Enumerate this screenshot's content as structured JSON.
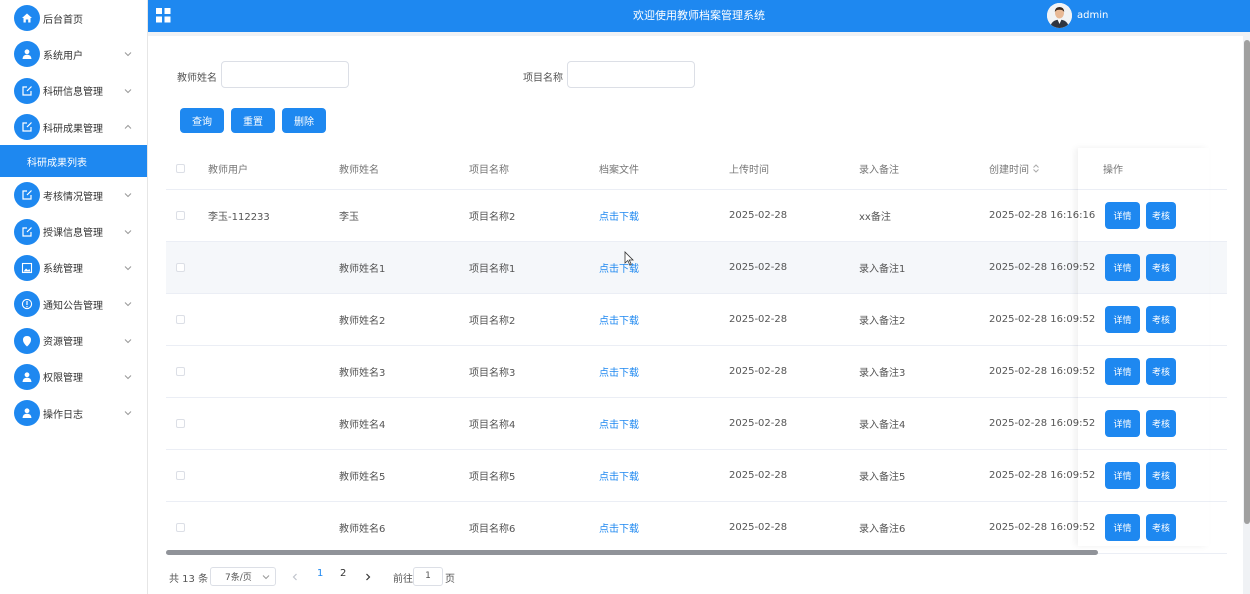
{
  "header": {
    "title": "欢迎使用教师档案管理系统",
    "username": "admin"
  },
  "sidebar": {
    "items": [
      {
        "label": "后台首页",
        "icon": "home-icon",
        "chevron": false
      },
      {
        "label": "系统用户",
        "icon": "user-icon",
        "chevron": "down"
      },
      {
        "label": "科研信息管理",
        "icon": "edit-icon",
        "chevron": "down"
      },
      {
        "label": "科研成果管理",
        "icon": "edit-icon",
        "chevron": "up"
      },
      {
        "label": "考核情况管理",
        "icon": "edit-icon",
        "chevron": "down"
      },
      {
        "label": "授课信息管理",
        "icon": "edit-icon",
        "chevron": "down"
      },
      {
        "label": "系统管理",
        "icon": "image-icon",
        "chevron": "down"
      },
      {
        "label": "通知公告管理",
        "icon": "info-icon",
        "chevron": "down"
      },
      {
        "label": "资源管理",
        "icon": "location-icon",
        "chevron": "down"
      },
      {
        "label": "权限管理",
        "icon": "user-icon",
        "chevron": "down"
      },
      {
        "label": "操作日志",
        "icon": "user-icon",
        "chevron": "down"
      }
    ],
    "active_sub": "科研成果列表"
  },
  "search": {
    "teacher_label": "教师姓名",
    "project_label": "项目名称",
    "query_btn": "查询",
    "reset_btn": "重置",
    "delete_btn": "删除"
  },
  "table": {
    "columns": [
      "教师用户",
      "教师姓名",
      "项目名称",
      "档案文件",
      "上传时间",
      "录入备注",
      "创建时间",
      "操作"
    ],
    "rows": [
      {
        "user": "李玉-112233",
        "name": "李玉",
        "project": "项目名称2",
        "file": "点击下载",
        "upload": "2025-02-28",
        "note": "xx备注",
        "created": "2025-02-28 16:16:16"
      },
      {
        "user": "",
        "name": "教师姓名1",
        "project": "项目名称1",
        "file": "点击下载",
        "upload": "2025-02-28",
        "note": "录入备注1",
        "created": "2025-02-28 16:09:52"
      },
      {
        "user": "",
        "name": "教师姓名2",
        "project": "项目名称2",
        "file": "点击下载",
        "upload": "2025-02-28",
        "note": "录入备注2",
        "created": "2025-02-28 16:09:52"
      },
      {
        "user": "",
        "name": "教师姓名3",
        "project": "项目名称3",
        "file": "点击下载",
        "upload": "2025-02-28",
        "note": "录入备注3",
        "created": "2025-02-28 16:09:52"
      },
      {
        "user": "",
        "name": "教师姓名4",
        "project": "项目名称4",
        "file": "点击下载",
        "upload": "2025-02-28",
        "note": "录入备注4",
        "created": "2025-02-28 16:09:52"
      },
      {
        "user": "",
        "name": "教师姓名5",
        "project": "项目名称5",
        "file": "点击下载",
        "upload": "2025-02-28",
        "note": "录入备注5",
        "created": "2025-02-28 16:09:52"
      },
      {
        "user": "",
        "name": "教师姓名6",
        "project": "项目名称6",
        "file": "点击下载",
        "upload": "2025-02-28",
        "note": "录入备注6",
        "created": "2025-02-28 16:09:52"
      }
    ],
    "detail_btn": "详情",
    "audit_btn": "考核"
  },
  "pagination": {
    "total": "共 13 条",
    "page_size": "7条/页",
    "pages": [
      "1",
      "2"
    ],
    "current": "1",
    "goto_label": "前往",
    "goto_value": "1",
    "page_suffix": "页"
  },
  "colors": {
    "primary": "#1e88f0"
  }
}
